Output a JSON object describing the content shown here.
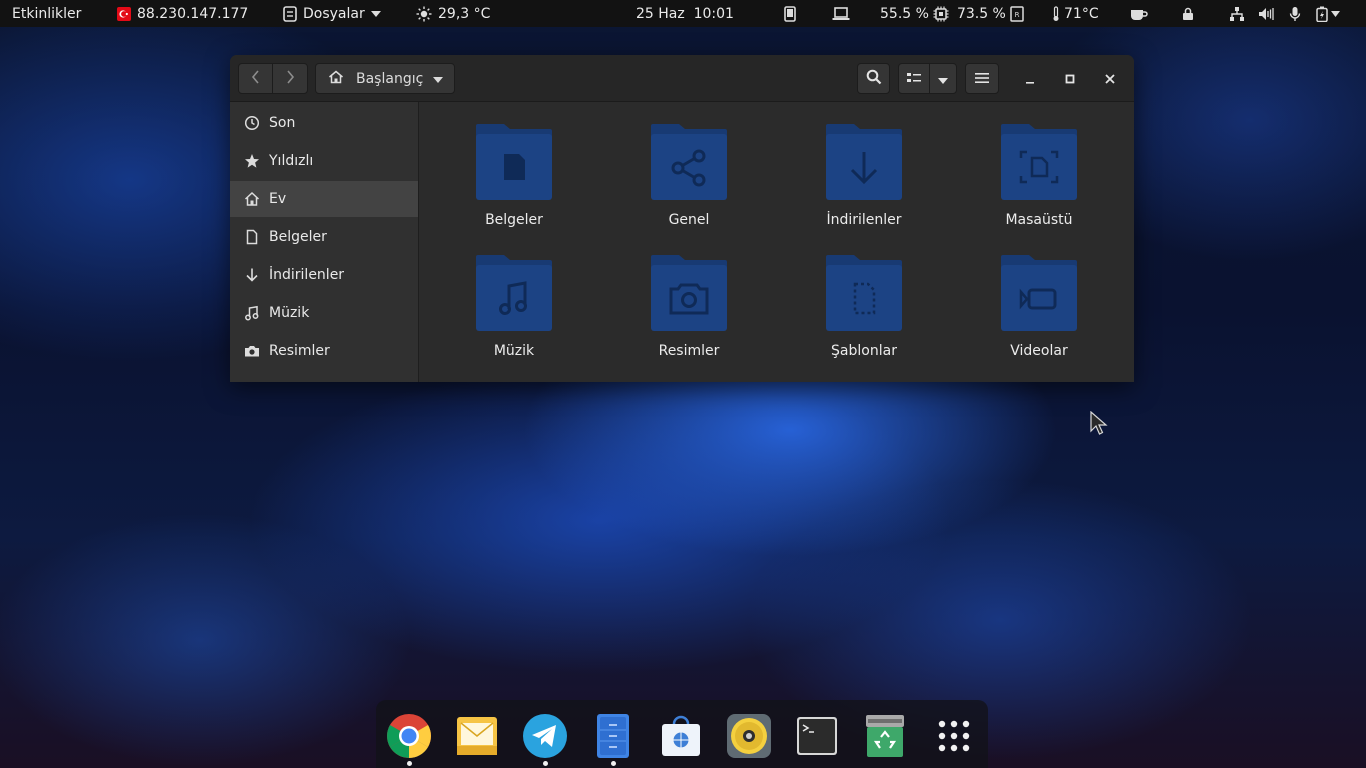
{
  "topbar": {
    "activities": "Etkinlikler",
    "ip": "88.230.147.177",
    "app_menu": "Dosyalar",
    "weather": "29,3 °C",
    "datetime": "25 Haz  10:01",
    "cpu": "55.5 %",
    "memory": "73.5 %",
    "temperature": "71°C"
  },
  "window": {
    "path": "Başlangıç"
  },
  "sidebar": {
    "items": [
      {
        "label": "Son",
        "icon": "clock-icon"
      },
      {
        "label": "Yıldızlı",
        "icon": "star-icon"
      },
      {
        "label": "Ev",
        "icon": "home-icon"
      },
      {
        "label": "Belgeler",
        "icon": "document-icon"
      },
      {
        "label": "İndirilenler",
        "icon": "download-icon"
      },
      {
        "label": "Müzik",
        "icon": "music-icon"
      },
      {
        "label": "Resimler",
        "icon": "camera-icon"
      }
    ]
  },
  "folders": [
    {
      "label": "Belgeler",
      "icon": "document-folder-icon"
    },
    {
      "label": "Genel",
      "icon": "share-folder-icon"
    },
    {
      "label": "İndirilenler",
      "icon": "download-folder-icon"
    },
    {
      "label": "Masaüstü",
      "icon": "desktop-folder-icon"
    },
    {
      "label": "Müzik",
      "icon": "music-folder-icon"
    },
    {
      "label": "Resimler",
      "icon": "pictures-folder-icon"
    },
    {
      "label": "Şablonlar",
      "icon": "templates-folder-icon"
    },
    {
      "label": "Videolar",
      "icon": "videos-folder-icon"
    }
  ],
  "dock": {
    "apps": [
      "chrome-icon",
      "mail-icon",
      "telegram-icon",
      "files-icon",
      "software-store-icon",
      "rhythmbox-icon",
      "terminal-icon",
      "trash-icon",
      "app-grid-icon"
    ]
  },
  "colors": {
    "folder_body": "#1c4384",
    "folder_tab": "#183a73",
    "folder_glyph": "#0f2a57",
    "topbar_bg": "#121212",
    "sidebar_active": "#434343"
  }
}
